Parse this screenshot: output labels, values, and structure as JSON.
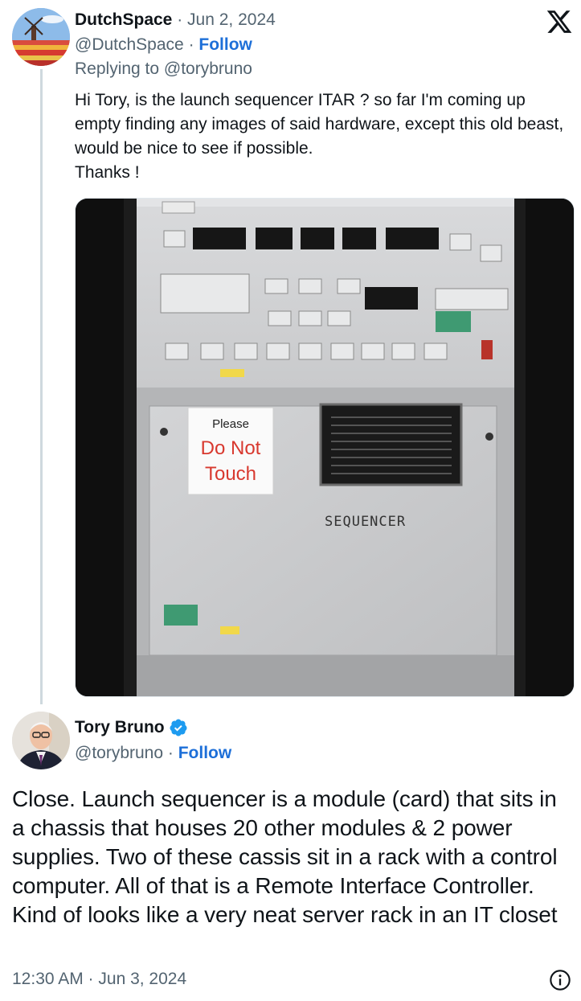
{
  "reply": {
    "name": "DutchSpace",
    "date": "Jun 2, 2024",
    "handle": "@DutchSpace",
    "follow_label": "Follow",
    "replying_to": "Replying to @torybruno",
    "text_lines": [
      "Hi Tory, is the launch sequencer ITAR ? so far I'm coming up empty finding any images of said hardware, except this old beast, would be nice to see if possible.",
      "Thanks !"
    ],
    "photo": {
      "sign_line1": "Please",
      "sign_line2": "Do Not",
      "sign_line3": "Touch",
      "panel_label": "SEQUENCER"
    }
  },
  "tweet": {
    "name": "Tory Bruno",
    "handle": "@torybruno",
    "follow_label": "Follow",
    "text": "Close. Launch sequencer is a module (card) that sits in a chassis that houses 20 other modules & 2 power supplies. Two of these cassis sit in a rack with a control computer. All of that is a Remote Interface Controller. Kind of looks like a very neat server rack in an IT closet",
    "timestamp": "12:30 AM · Jun 3, 2024"
  },
  "icons": {
    "logo": "x-logo-icon",
    "verified": "verified-badge-icon",
    "info": "info-icon"
  },
  "colors": {
    "follow": "#1d6fd8",
    "verified": "#1d9bf0",
    "muted": "#536471"
  }
}
